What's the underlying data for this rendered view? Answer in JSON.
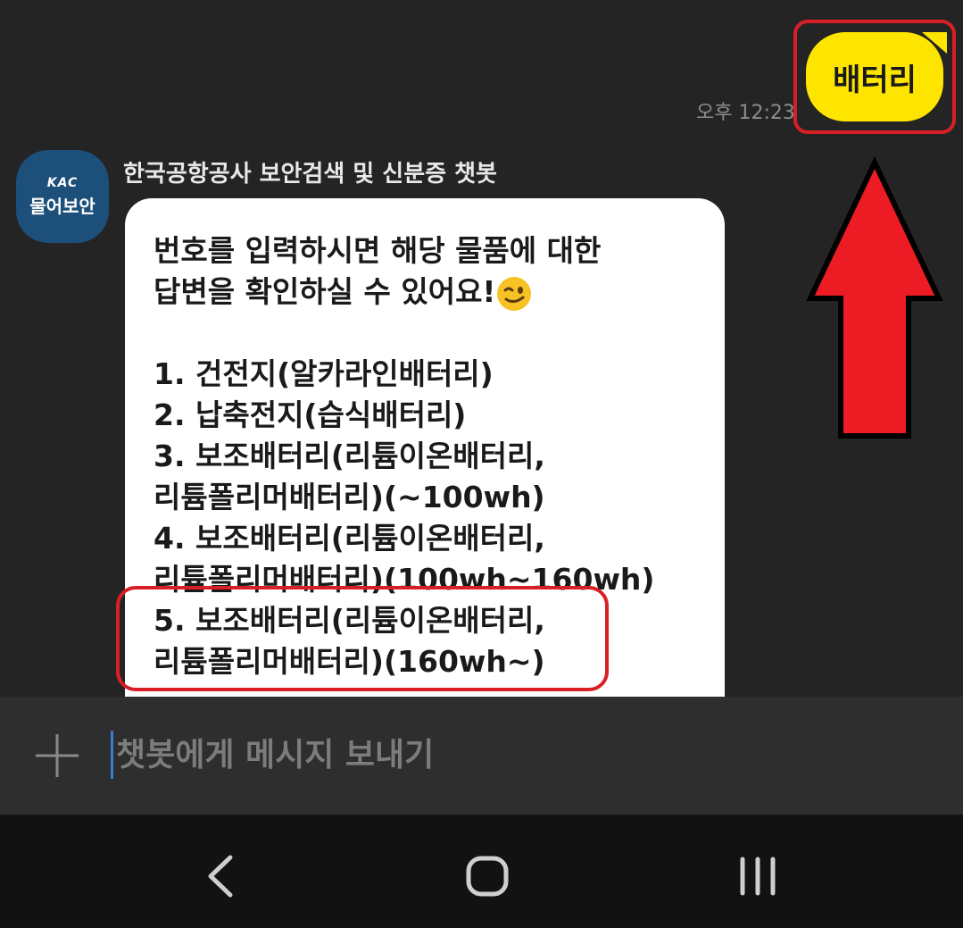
{
  "user_message": {
    "text": "배터리",
    "time": "오후 12:23"
  },
  "bot": {
    "name": "한국공항공사 보안검색 및 신분증 챗봇",
    "avatar": {
      "brand": "KAC",
      "title": "물어보안"
    },
    "message_lines": [
      "번호를 입력하시면 해당 물품에 대한",
      "답변을 확인하실 수 있어요!",
      "",
      "1. 건전지(알카라인배터리)",
      "2. 납축전지(습식배터리)",
      "3. 보조배터리(리튬이온배터리,",
      "리튬폴리머배터리)(~100wh)",
      "4. 보조배터리(리튬이온배터리,",
      "리튬폴리머배터리)(100wh~160wh)",
      "5. 보조배터리(리튬이온배터리,",
      "리튬폴리머배터리)(160wh~)"
    ],
    "emoji": "winking-face-icon"
  },
  "input": {
    "placeholder": "챗봇에게 메시지 보내기",
    "value": ""
  },
  "icons": [
    "plus-icon",
    "back-icon",
    "home-icon",
    "recents-icon",
    "red-arrow-up-icon"
  ],
  "colors": {
    "user_bubble": "#fee500",
    "highlight": "#d91f26",
    "avatar": "#1c4f7a",
    "background": "#242424"
  }
}
